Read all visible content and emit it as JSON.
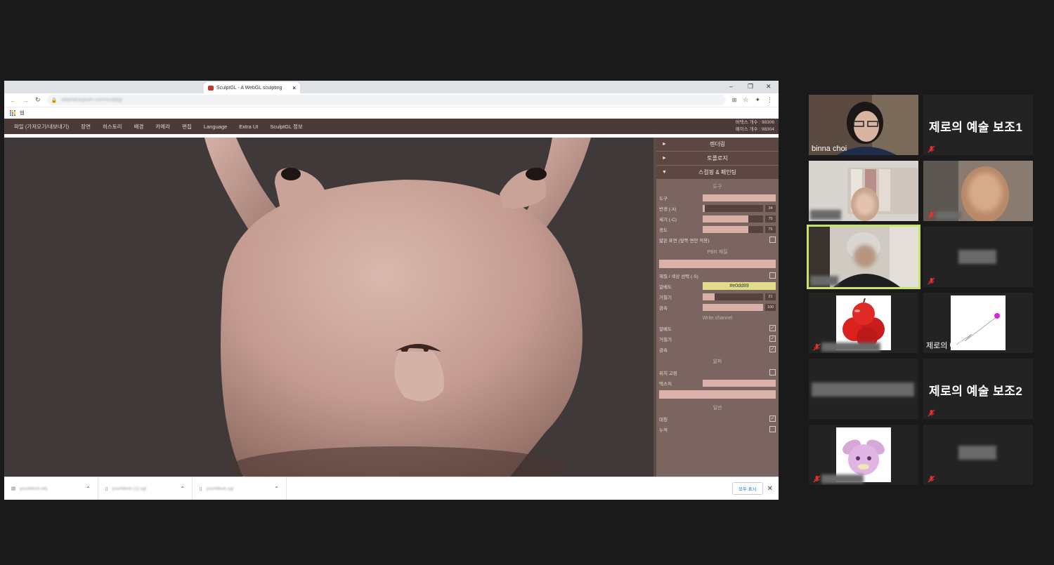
{
  "browser": {
    "tab_title": "SculptGL - A WebGL sculpting",
    "tab_close": "×",
    "controls": [
      "–",
      "❐",
      "✕"
    ],
    "url": "stephaneginier.com/sculptgl",
    "bookmark_label": "웹"
  },
  "sculptgl": {
    "menu": [
      "파일 (가져오기/내보내기)",
      "장면",
      "히스토리",
      "배경",
      "카메라",
      "편집",
      "Language",
      "Extra UI",
      "SculptGL 정보"
    ],
    "stats": {
      "vertices": "버텍스 개수 : 98306",
      "faces": "페이스 개수 : 98304"
    },
    "panel": {
      "sections": [
        "렌더링",
        "토폴로지",
        "스컬핑 & 페인팅"
      ],
      "tool_header": "도구",
      "tool_label": "도구",
      "radius_label": "반경 (-X)",
      "radius_value": "34",
      "radius_level": 0.03,
      "intensity_label": "세기 (-C)",
      "intensity_value": "75",
      "intensity_level": 0.75,
      "hardness_label": "경도",
      "hardness_value": "75",
      "hardness_level": 0.75,
      "cull_label": "얇은 표면 (앞쪽 면만 적용)",
      "pbr_header": "PBR 재질",
      "material_label": "재질 / 색상 선택 (-S)",
      "albedo_label": "알베도",
      "albedo_value": "#e0dd89",
      "roughness_label": "거칠기",
      "roughness_value": "21",
      "roughness_level": 0.2,
      "metal_label": "금속",
      "metal_value": "100",
      "metal_level": 1.0,
      "write_header": "Write channel",
      "write_albedo": "알베도",
      "write_roughness": "거칠기",
      "write_metal": "금속",
      "alpha_header": "알파",
      "lock_label": "위치 고정",
      "texture_label": "텍스처",
      "general_header": "일반",
      "symmetry_label": "대칭",
      "continuous_label": "누적"
    },
    "colors": {
      "menubar": "#4a3b38",
      "panel": "#7a6560",
      "model": "#c9a399",
      "albedo": "#e0dd89"
    }
  },
  "downloads": {
    "files": [
      "yourMesh.obj",
      "yourMesh (1).sgl",
      "yourMesh.sgl"
    ],
    "show_all": "모두 표시",
    "close": "✕"
  },
  "participants": [
    {
      "name": "binna choi",
      "type": "video"
    },
    {
      "name": "제로의 예술 보조1",
      "type": "name"
    },
    {
      "name": "",
      "type": "video"
    },
    {
      "name": "",
      "type": "video"
    },
    {
      "name": "",
      "type": "video",
      "active": true
    },
    {
      "name": "",
      "type": "blank"
    },
    {
      "name": "",
      "type": "image"
    },
    {
      "name": "제로의 예술 - 전...",
      "type": "image"
    },
    {
      "name": "",
      "type": "blank"
    },
    {
      "name": "제로의 예술 보조2",
      "type": "name"
    },
    {
      "name": "",
      "type": "image"
    },
    {
      "name": "",
      "type": "blank"
    }
  ]
}
